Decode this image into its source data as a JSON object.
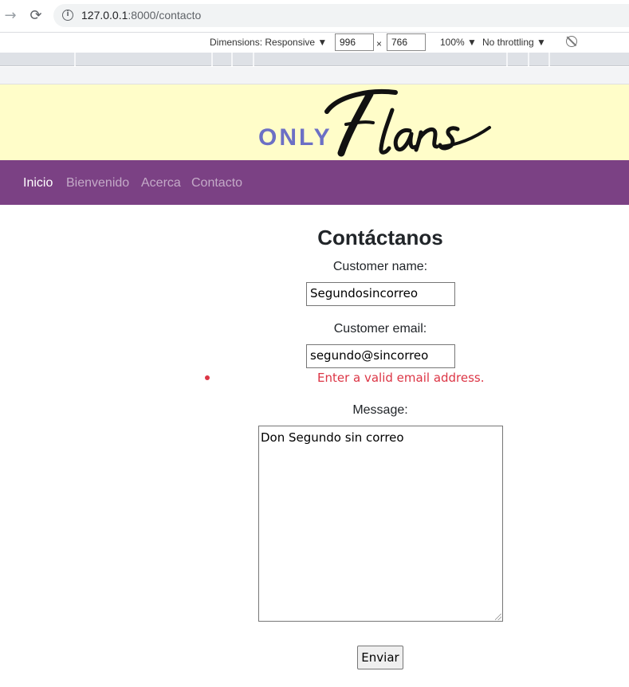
{
  "browser": {
    "url_host": "127.0.0.1",
    "url_path": ":8000/contacto",
    "forward_icon": "arrow-right",
    "reload_icon": "reload"
  },
  "devtools": {
    "dimensions_label": "Dimensions: Responsive ▼",
    "width": "996",
    "times": "×",
    "height": "766",
    "zoom": "100% ▼",
    "throttling": "No throttling ▼"
  },
  "header": {
    "logo_only": "ONLY",
    "logo_script": "Flans",
    "banner_color": "#fffdc9"
  },
  "navbar": {
    "color": "#7b4184",
    "items": [
      {
        "label": "Inicio",
        "active": true
      },
      {
        "label": "Bienvenido",
        "active": false
      },
      {
        "label": "Acerca",
        "active": false
      },
      {
        "label": "Contacto",
        "active": false
      }
    ]
  },
  "form": {
    "title": "Contáctanos",
    "name_label": "Customer name:",
    "name_value": "Segundosincorreo",
    "email_label": "Customer email:",
    "email_value": "segundo@sincorreo",
    "email_error": "Enter a valid email address.",
    "message_label": "Message:",
    "message_value": "Don Segundo sin correo",
    "submit_label": "Enviar",
    "error_color": "#dc3545"
  }
}
